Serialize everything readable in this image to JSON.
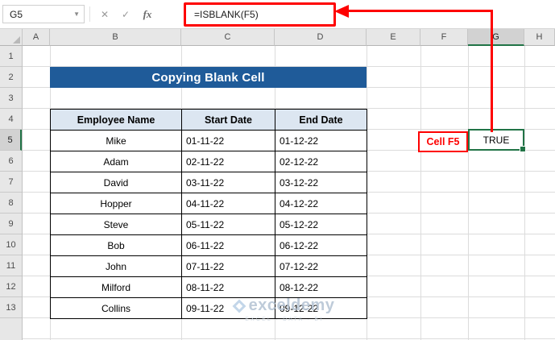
{
  "colors": {
    "banner_blue": "#1f5b99",
    "table_header_blue": "#dce6f1",
    "annotation_red": "#fe0000",
    "selection_green": "#217346"
  },
  "formula_bar": {
    "name_box": "G5",
    "cancel": "✕",
    "enter": "✓",
    "fx": "fx",
    "formula": "=ISBLANK(F5)"
  },
  "grid": {
    "column_headers": [
      "A",
      "B",
      "C",
      "D",
      "E",
      "F",
      "G",
      "H"
    ],
    "row_headers": [
      "1",
      "2",
      "3",
      "4",
      "5",
      "6",
      "7",
      "8",
      "9",
      "10",
      "11",
      "12",
      "13"
    ],
    "selected_cell": "G5"
  },
  "sheet": {
    "banner_title": "Copying Blank Cell",
    "table": {
      "headers": [
        "Employee Name",
        "Start Date",
        "End Date"
      ],
      "rows": [
        [
          "Mike",
          "01-11-22",
          "01-12-22"
        ],
        [
          "Adam",
          "02-11-22",
          "02-12-22"
        ],
        [
          "David",
          "03-11-22",
          "03-12-22"
        ],
        [
          "Hopper",
          "04-11-22",
          "04-12-22"
        ],
        [
          "Steve",
          "05-11-22",
          "05-12-22"
        ],
        [
          "Bob",
          "06-11-22",
          "06-12-22"
        ],
        [
          "John",
          "07-11-22",
          "07-12-22"
        ],
        [
          "Milford",
          "08-11-22",
          "08-12-22"
        ],
        [
          "Collins",
          "09-11-22",
          "09-12-22"
        ]
      ]
    },
    "callout_label": "Cell F5",
    "result_value": "TRUE"
  },
  "watermark": {
    "brand": "exceldemy",
    "tagline": "EXCEL · DATA · BI"
  }
}
